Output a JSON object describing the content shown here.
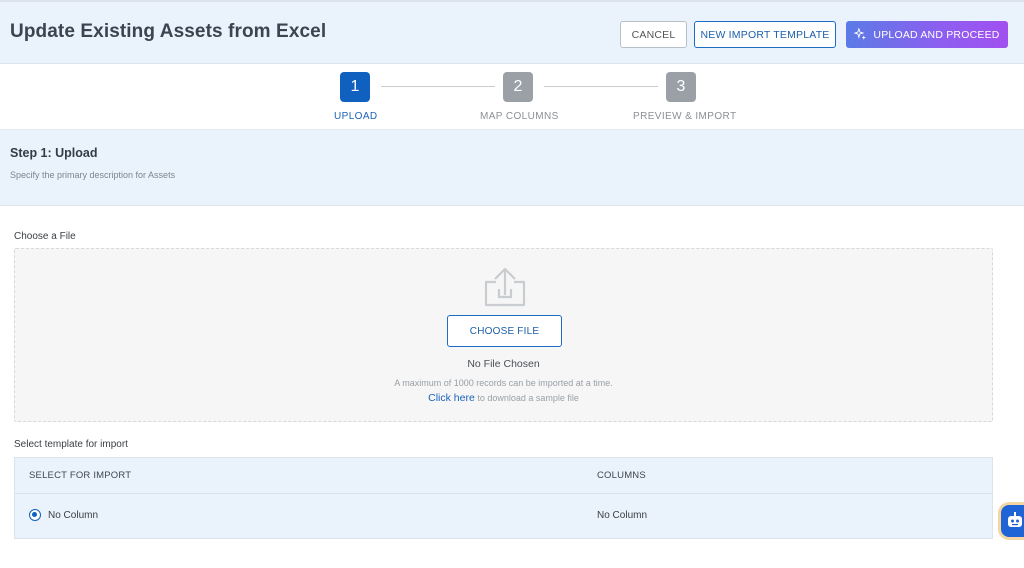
{
  "header": {
    "title": "Update Existing Assets from Excel",
    "cancel_label": "CANCEL",
    "new_template_label": "NEW IMPORT TEMPLATE",
    "upload_proceed_label": "UPLOAD AND PROCEED"
  },
  "stepper": {
    "steps": [
      {
        "number": "1",
        "label": "UPLOAD",
        "state": "active"
      },
      {
        "number": "2",
        "label": "MAP COLUMNS",
        "state": "inactive"
      },
      {
        "number": "3",
        "label": "PREVIEW & IMPORT",
        "state": "inactive"
      }
    ]
  },
  "step": {
    "title": "Step 1: Upload",
    "subtitle": "Specify the primary description for Assets"
  },
  "upload": {
    "label": "Choose a File",
    "choose_button": "CHOOSE FILE",
    "status": "No File Chosen",
    "max_note": "A maximum of 1000 records can be imported at a time.",
    "sample_link": "Click here",
    "sample_text": " to download a sample file"
  },
  "template": {
    "label": "Select template for import",
    "columns": [
      "SELECT FOR IMPORT",
      "COLUMNS"
    ],
    "rows": [
      {
        "name": "No Column",
        "columns": "No Column",
        "selected": true
      }
    ]
  },
  "colors": {
    "accent": "#1060c0",
    "header_bg": "#eaf2fb",
    "upload_gradient_start": "#5b7be6",
    "upload_gradient_end": "#a24ff0",
    "inactive_step": "#9aa0a6"
  },
  "icons": {
    "upload_proceed": "sparkle-icon",
    "dropzone": "upload-tray-icon",
    "assistant": "chatbot-icon"
  }
}
